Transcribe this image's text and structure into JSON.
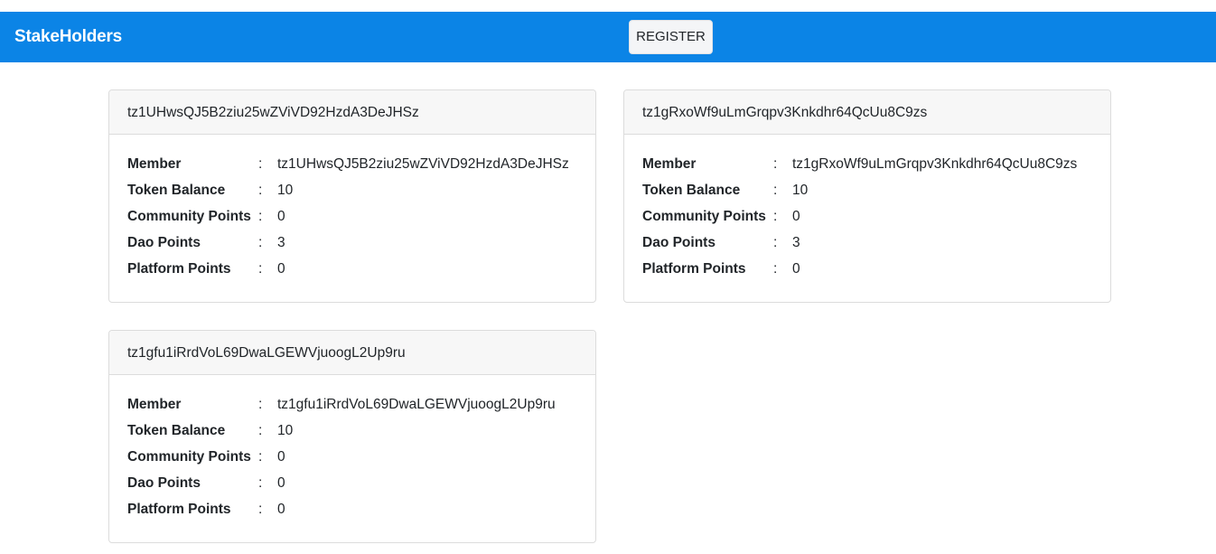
{
  "header": {
    "brand": "StakeHolders",
    "register_label": "REGISTER"
  },
  "separator": ":",
  "cards": [
    {
      "title": "tz1UHwsQJ5B2ziu25wZViVD92HzdA3DeJHSz",
      "rows": [
        {
          "label": "Member",
          "value": "tz1UHwsQJ5B2ziu25wZViVD92HzdA3DeJHSz"
        },
        {
          "label": "Token Balance",
          "value": "10"
        },
        {
          "label": "Community Points",
          "value": "0"
        },
        {
          "label": "Dao Points",
          "value": "3"
        },
        {
          "label": "Platform Points",
          "value": "0"
        }
      ]
    },
    {
      "title": "tz1gRxoWf9uLmGrqpv3Knkdhr64QcUu8C9zs",
      "rows": [
        {
          "label": "Member",
          "value": "tz1gRxoWf9uLmGrqpv3Knkdhr64QcUu8C9zs"
        },
        {
          "label": "Token Balance",
          "value": "10"
        },
        {
          "label": "Community Points",
          "value": "0"
        },
        {
          "label": "Dao Points",
          "value": "3"
        },
        {
          "label": "Platform Points",
          "value": "0"
        }
      ]
    },
    {
      "title": "tz1gfu1iRrdVoL69DwaLGEWVjuoogL2Up9ru",
      "rows": [
        {
          "label": "Member",
          "value": "tz1gfu1iRrdVoL69DwaLGEWVjuoogL2Up9ru"
        },
        {
          "label": "Token Balance",
          "value": "10"
        },
        {
          "label": "Community Points",
          "value": "0"
        },
        {
          "label": "Dao Points",
          "value": "0"
        },
        {
          "label": "Platform Points",
          "value": "0"
        }
      ]
    }
  ]
}
